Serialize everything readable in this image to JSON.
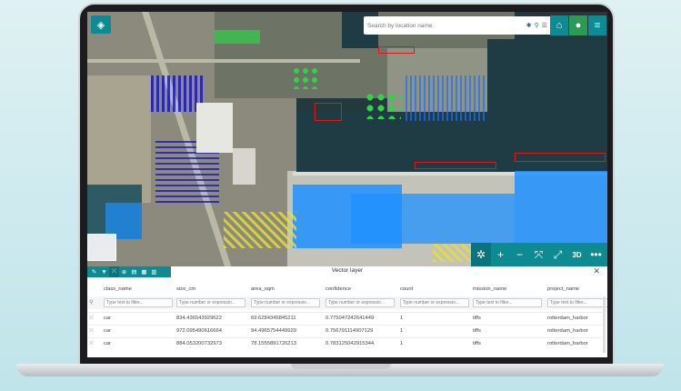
{
  "search": {
    "placeholder": "Search by location name"
  },
  "icons": {
    "logo": "layers-icon",
    "search_options": "gear-icon",
    "search": "search-icon",
    "search_list": "list-icon",
    "home": "home-icon",
    "user": "user-icon",
    "menu": "hamburger-menu-icon"
  },
  "map_controls": [
    {
      "name": "compass-button",
      "icon": "compass-icon",
      "glyph": "✲"
    },
    {
      "name": "zoom-in-button",
      "icon": "plus-icon",
      "glyph": "+"
    },
    {
      "name": "zoom-out-button",
      "icon": "minus-icon",
      "glyph": "−"
    },
    {
      "name": "fit-extent-button",
      "icon": "expand-arrows-icon",
      "glyph": "⤧"
    },
    {
      "name": "fullscreen-button",
      "icon": "fullscreen-icon",
      "glyph": "⤢"
    },
    {
      "name": "3d-toggle-button",
      "icon": "",
      "glyph": "3D"
    },
    {
      "name": "more-options-button",
      "icon": "more-dots-icon",
      "glyph": "•••"
    }
  ],
  "panel": {
    "title": "Vector layer",
    "toolbar": [
      "pencil-icon",
      "filter-icon",
      "select-icon",
      "target-icon",
      "table-icon",
      "grid-icon",
      "chart-icon"
    ],
    "columns": [
      "class_name",
      "size_cm",
      "area_sqm",
      "confidence",
      "count",
      "mission_name",
      "project_name"
    ],
    "filters": [
      "Type text to filter...",
      "Type number or expressio...",
      "Type number or expressio...",
      "Type number or expressio...",
      "Type number or expressio...",
      "Type text to filter...",
      "Type text to filter..."
    ],
    "rows": [
      [
        "car",
        "834.436543929622",
        "69.6284345845211",
        "0.775047242641449",
        "1",
        "tiffs",
        "rotterdam_harbor"
      ],
      [
        "car",
        "972.095490616664",
        "94.4965754449929",
        "0.756791114907129",
        "1",
        "tiffs",
        "rotterdam_harbor"
      ],
      [
        "car",
        "884.053200732973",
        "78.1555891726213",
        "0.783125042915344",
        "1",
        "tiffs",
        "rotterdam_harbor"
      ]
    ]
  },
  "colors": {
    "accent": "#0e8a93",
    "user_button": "#2c9a55",
    "detection_water": "#1e90ff",
    "detection_car": "#1010c8",
    "detection_green": "#2fd24a",
    "detection_yellow": "#e8e030",
    "detection_red": "#e01818"
  }
}
